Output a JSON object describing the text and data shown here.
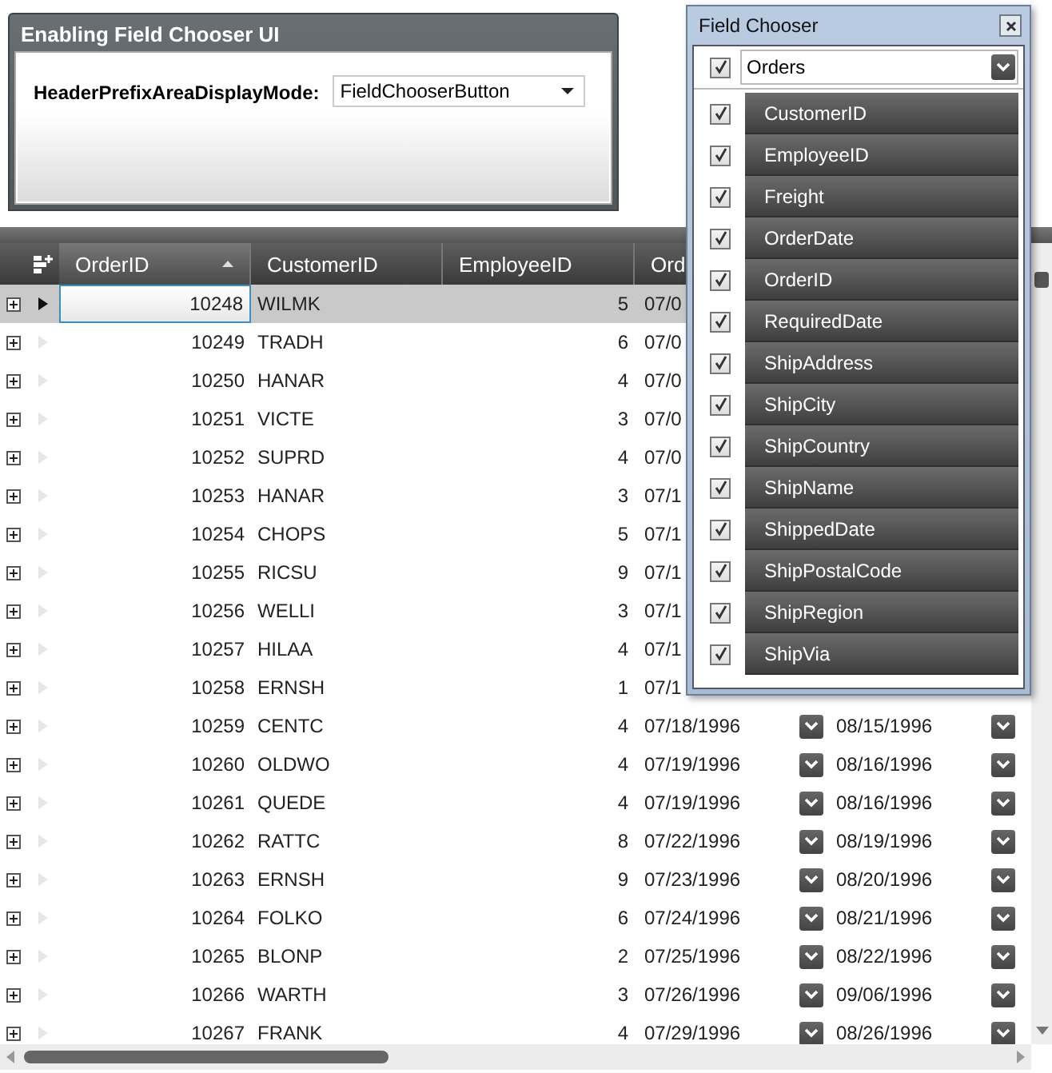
{
  "panel": {
    "title": "Enabling Field Chooser UI",
    "label": "HeaderPrefixAreaDisplayMode:",
    "select_value": "FieldChooserButton"
  },
  "grid": {
    "columns": [
      {
        "label": "OrderID",
        "sorted": true
      },
      {
        "label": "CustomerID",
        "sorted": false
      },
      {
        "label": "EmployeeID",
        "sorted": false
      },
      {
        "label": "Ord",
        "sorted": false
      }
    ],
    "rows": [
      {
        "order_id": "10248",
        "customer_id": "WILMK",
        "employee_id": "5",
        "order_date": "07/0",
        "selected": true
      },
      {
        "order_id": "10249",
        "customer_id": "TRADH",
        "employee_id": "6",
        "order_date": "07/0",
        "selected": false
      },
      {
        "order_id": "10250",
        "customer_id": "HANAR",
        "employee_id": "4",
        "order_date": "07/0",
        "selected": false
      },
      {
        "order_id": "10251",
        "customer_id": "VICTE",
        "employee_id": "3",
        "order_date": "07/0",
        "selected": false
      },
      {
        "order_id": "10252",
        "customer_id": "SUPRD",
        "employee_id": "4",
        "order_date": "07/0",
        "selected": false
      },
      {
        "order_id": "10253",
        "customer_id": "HANAR",
        "employee_id": "3",
        "order_date": "07/1",
        "selected": false
      },
      {
        "order_id": "10254",
        "customer_id": "CHOPS",
        "employee_id": "5",
        "order_date": "07/1",
        "selected": false
      },
      {
        "order_id": "10255",
        "customer_id": "RICSU",
        "employee_id": "9",
        "order_date": "07/1",
        "selected": false
      },
      {
        "order_id": "10256",
        "customer_id": "WELLI",
        "employee_id": "3",
        "order_date": "07/1",
        "selected": false
      },
      {
        "order_id": "10257",
        "customer_id": "HILAA",
        "employee_id": "4",
        "order_date": "07/1",
        "selected": false
      },
      {
        "order_id": "10258",
        "customer_id": "ERNSH",
        "employee_id": "1",
        "order_date": "07/1",
        "selected": false
      },
      {
        "order_id": "10259",
        "customer_id": "CENTC",
        "employee_id": "4",
        "order_date": "07/18/1996",
        "required_date": "08/15/1996",
        "selected": false
      },
      {
        "order_id": "10260",
        "customer_id": "OLDWO",
        "employee_id": "4",
        "order_date": "07/19/1996",
        "required_date": "08/16/1996",
        "selected": false
      },
      {
        "order_id": "10261",
        "customer_id": "QUEDE",
        "employee_id": "4",
        "order_date": "07/19/1996",
        "required_date": "08/16/1996",
        "selected": false
      },
      {
        "order_id": "10262",
        "customer_id": "RATTC",
        "employee_id": "8",
        "order_date": "07/22/1996",
        "required_date": "08/19/1996",
        "selected": false
      },
      {
        "order_id": "10263",
        "customer_id": "ERNSH",
        "employee_id": "9",
        "order_date": "07/23/1996",
        "required_date": "08/20/1996",
        "selected": false
      },
      {
        "order_id": "10264",
        "customer_id": "FOLKO",
        "employee_id": "6",
        "order_date": "07/24/1996",
        "required_date": "08/21/1996",
        "selected": false
      },
      {
        "order_id": "10265",
        "customer_id": "BLONP",
        "employee_id": "2",
        "order_date": "07/25/1996",
        "required_date": "08/22/1996",
        "selected": false
      },
      {
        "order_id": "10266",
        "customer_id": "WARTH",
        "employee_id": "3",
        "order_date": "07/26/1996",
        "required_date": "09/06/1996",
        "selected": false
      },
      {
        "order_id": "10267",
        "customer_id": "FRANK",
        "employee_id": "4",
        "order_date": "07/29/1996",
        "required_date": "08/26/1996",
        "selected": false
      }
    ]
  },
  "field_chooser": {
    "title": "Field Chooser",
    "table": "Orders",
    "table_checked": true,
    "fields": [
      {
        "label": "CustomerID",
        "checked": true
      },
      {
        "label": "EmployeeID",
        "checked": true
      },
      {
        "label": "Freight",
        "checked": true
      },
      {
        "label": "OrderDate",
        "checked": true
      },
      {
        "label": "OrderID",
        "checked": true
      },
      {
        "label": "RequiredDate",
        "checked": true
      },
      {
        "label": "ShipAddress",
        "checked": true
      },
      {
        "label": "ShipCity",
        "checked": true
      },
      {
        "label": "ShipCountry",
        "checked": true
      },
      {
        "label": "ShipName",
        "checked": true
      },
      {
        "label": "ShippedDate",
        "checked": true
      },
      {
        "label": "ShipPostalCode",
        "checked": true
      },
      {
        "label": "ShipRegion",
        "checked": true
      },
      {
        "label": "ShipVia",
        "checked": true
      }
    ]
  }
}
